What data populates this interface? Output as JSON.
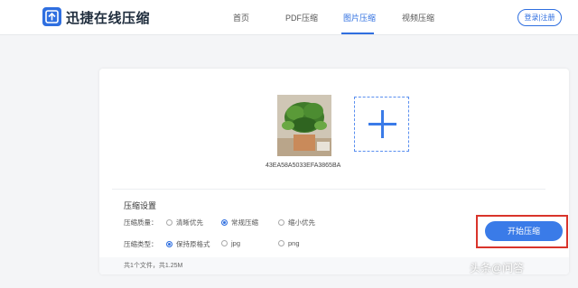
{
  "header": {
    "brand": "迅捷在线压缩",
    "nav": [
      {
        "label": "首页"
      },
      {
        "label": "PDF压缩"
      },
      {
        "label": "图片压缩",
        "active": true
      },
      {
        "label": "视频压缩"
      }
    ],
    "login_label": "登录|注册"
  },
  "colors": {
    "accent": "#2f6fe0",
    "highlight_box": "#d9342b"
  },
  "upload": {
    "file_name": "43EA58A5033EFA3865BA",
    "add_icon": "plus-icon"
  },
  "settings": {
    "title": "压缩设置",
    "quality": {
      "label": "压缩质量：",
      "options": [
        {
          "label": "清晰优先",
          "checked": false
        },
        {
          "label": "常规压缩",
          "checked": true
        },
        {
          "label": "缩小优先",
          "checked": false
        }
      ]
    },
    "type": {
      "label": "压缩类型：",
      "options": [
        {
          "label": "保持原格式",
          "checked": true
        },
        {
          "label": "jpg",
          "checked": false
        },
        {
          "label": "png",
          "checked": false
        }
      ]
    }
  },
  "footer": {
    "summary": "共1个文件，共1.25M"
  },
  "start_button": "开始压缩",
  "watermark": "头条@问答"
}
